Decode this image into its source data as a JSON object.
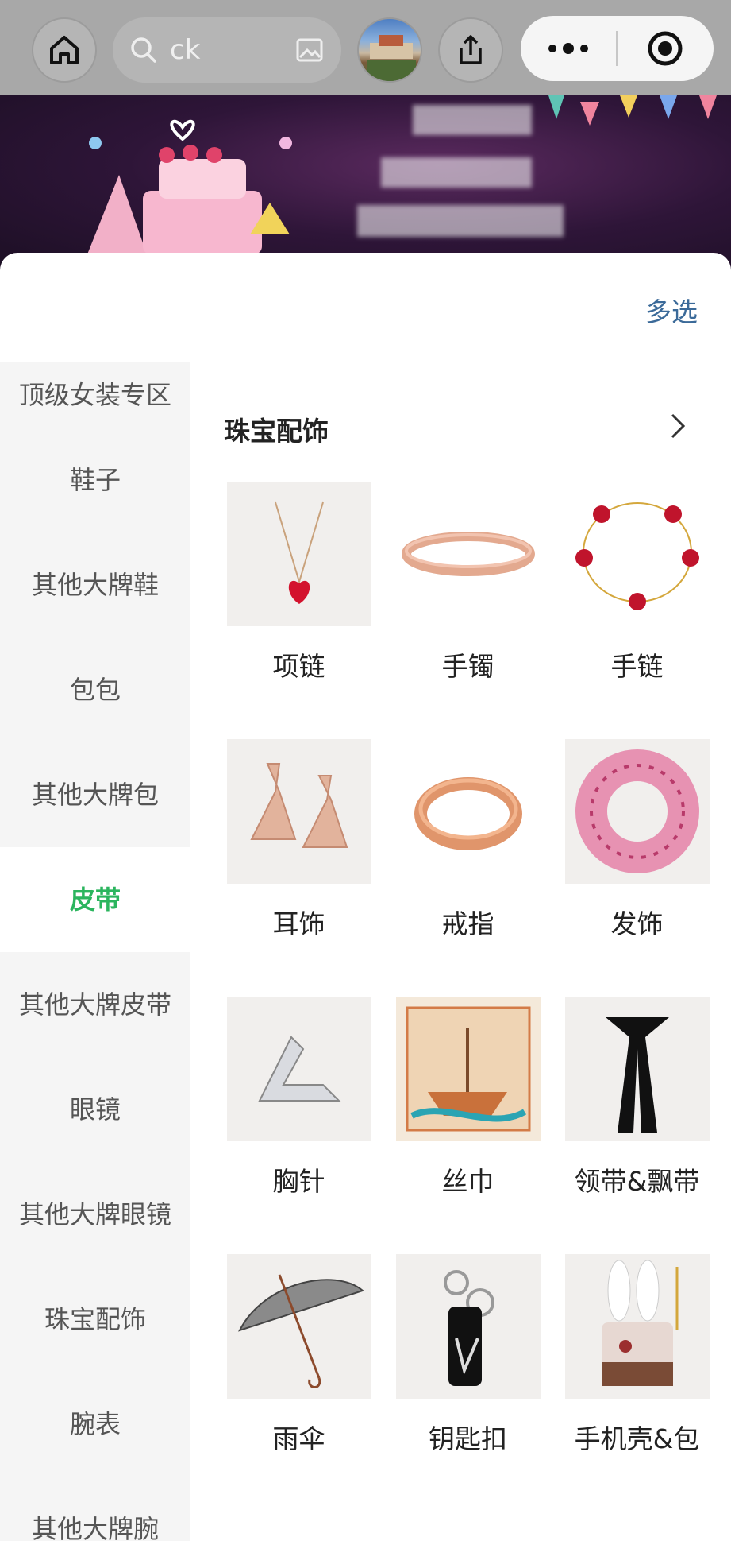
{
  "header": {
    "search_text": "ck"
  },
  "sheet": {
    "multi_select_label": "多选"
  },
  "sidebar": {
    "items": [
      {
        "label": "顶级女装专区"
      },
      {
        "label": "鞋子"
      },
      {
        "label": "其他大牌鞋"
      },
      {
        "label": "包包"
      },
      {
        "label": "其他大牌包"
      },
      {
        "label": "皮带",
        "active": true
      },
      {
        "label": "其他大牌皮带"
      },
      {
        "label": "眼镜"
      },
      {
        "label": "其他大牌眼镜"
      },
      {
        "label": "珠宝配饰"
      },
      {
        "label": "腕表"
      },
      {
        "label": "其他大牌腕"
      }
    ]
  },
  "section": {
    "title": "珠宝配饰",
    "categories": [
      {
        "label": "项链",
        "icon": "necklace-image"
      },
      {
        "label": "手镯",
        "icon": "bangle-image"
      },
      {
        "label": "手链",
        "icon": "bracelet-image"
      },
      {
        "label": "耳饰",
        "icon": "earrings-image"
      },
      {
        "label": "戒指",
        "icon": "ring-image"
      },
      {
        "label": "发饰",
        "icon": "scrunchie-image"
      },
      {
        "label": "胸针",
        "icon": "brooch-image"
      },
      {
        "label": "丝巾",
        "icon": "silk-scarf-image"
      },
      {
        "label": "领带&飘带",
        "icon": "tie-image"
      },
      {
        "label": "雨伞",
        "icon": "umbrella-image"
      },
      {
        "label": "钥匙扣",
        "icon": "keychain-image"
      },
      {
        "label": "手机壳&包",
        "icon": "phone-case-image"
      }
    ]
  },
  "colors": {
    "accent": "#2bb55e",
    "link": "#3b6a99",
    "sidebar_bg": "#f5f5f5"
  }
}
